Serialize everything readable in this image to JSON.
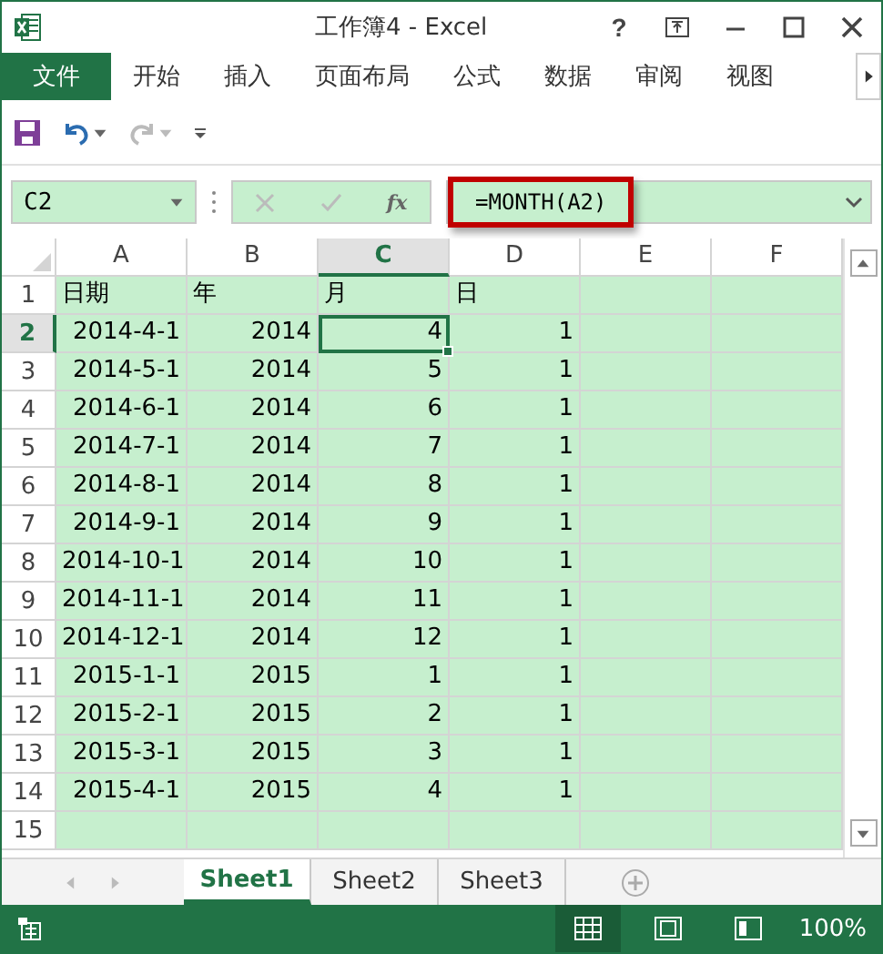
{
  "window": {
    "title": "工作簿4 - Excel",
    "controls": [
      "?"
    ]
  },
  "ribbon_tabs": [
    {
      "label": "文件",
      "kind": "file"
    },
    {
      "label": "开始",
      "kind": "tab"
    },
    {
      "label": "插入",
      "kind": "tab"
    },
    {
      "label": "页面布局",
      "kind": "tab"
    },
    {
      "label": "公式",
      "kind": "tab"
    },
    {
      "label": "数据",
      "kind": "tab"
    },
    {
      "label": "审阅",
      "kind": "tab"
    },
    {
      "label": "视图",
      "kind": "tab"
    }
  ],
  "formula_bar": {
    "name_box": "C2",
    "fx": "fx",
    "formula": "=MONTH(A2)",
    "highlighted": true
  },
  "columns": [
    {
      "label": "A",
      "selected": false
    },
    {
      "label": "B",
      "selected": false
    },
    {
      "label": "C",
      "selected": true
    },
    {
      "label": "D",
      "selected": false
    },
    {
      "label": "E",
      "selected": false
    },
    {
      "label": "F",
      "selected": false
    }
  ],
  "rows": [
    {
      "header": "1",
      "selected": false,
      "kind": "text",
      "cells": [
        "日期",
        "年",
        "月",
        "日"
      ]
    },
    {
      "header": "2",
      "selected": true,
      "kind": "number",
      "cells": [
        "2014-4-1",
        "2014",
        "4",
        "1"
      ]
    },
    {
      "header": "3",
      "selected": false,
      "kind": "number",
      "cells": [
        "2014-5-1",
        "2014",
        "5",
        "1"
      ]
    },
    {
      "header": "4",
      "selected": false,
      "kind": "number",
      "cells": [
        "2014-6-1",
        "2014",
        "6",
        "1"
      ]
    },
    {
      "header": "5",
      "selected": false,
      "kind": "number",
      "cells": [
        "2014-7-1",
        "2014",
        "7",
        "1"
      ]
    },
    {
      "header": "6",
      "selected": false,
      "kind": "number",
      "cells": [
        "2014-8-1",
        "2014",
        "8",
        "1"
      ]
    },
    {
      "header": "7",
      "selected": false,
      "kind": "number",
      "cells": [
        "2014-9-1",
        "2014",
        "9",
        "1"
      ]
    },
    {
      "header": "8",
      "selected": false,
      "kind": "number",
      "cells": [
        "2014-10-1",
        "2014",
        "10",
        "1"
      ]
    },
    {
      "header": "9",
      "selected": false,
      "kind": "number",
      "cells": [
        "2014-11-1",
        "2014",
        "11",
        "1"
      ]
    },
    {
      "header": "10",
      "selected": false,
      "kind": "number",
      "cells": [
        "2014-12-1",
        "2014",
        "12",
        "1"
      ]
    },
    {
      "header": "11",
      "selected": false,
      "kind": "number",
      "cells": [
        "2015-1-1",
        "2015",
        "1",
        "1"
      ]
    },
    {
      "header": "12",
      "selected": false,
      "kind": "number",
      "cells": [
        "2015-2-1",
        "2015",
        "2",
        "1"
      ]
    },
    {
      "header": "13",
      "selected": false,
      "kind": "number",
      "cells": [
        "2015-3-1",
        "2015",
        "3",
        "1"
      ]
    },
    {
      "header": "14",
      "selected": false,
      "kind": "number",
      "cells": [
        "2015-4-1",
        "2015",
        "4",
        "1"
      ]
    },
    {
      "header": "15",
      "selected": false,
      "kind": "number",
      "cells": []
    }
  ],
  "sheet_tabs": [
    {
      "label": "Sheet1",
      "selected": true
    },
    {
      "label": "Sheet2",
      "selected": false
    },
    {
      "label": "Sheet3",
      "selected": false
    }
  ],
  "status_bar": {
    "views": [
      {
        "kind": "normal",
        "selected": true
      },
      {
        "kind": "page_layout",
        "selected": false
      },
      {
        "kind": "page_break",
        "selected": false
      }
    ],
    "zoom": "100%"
  }
}
